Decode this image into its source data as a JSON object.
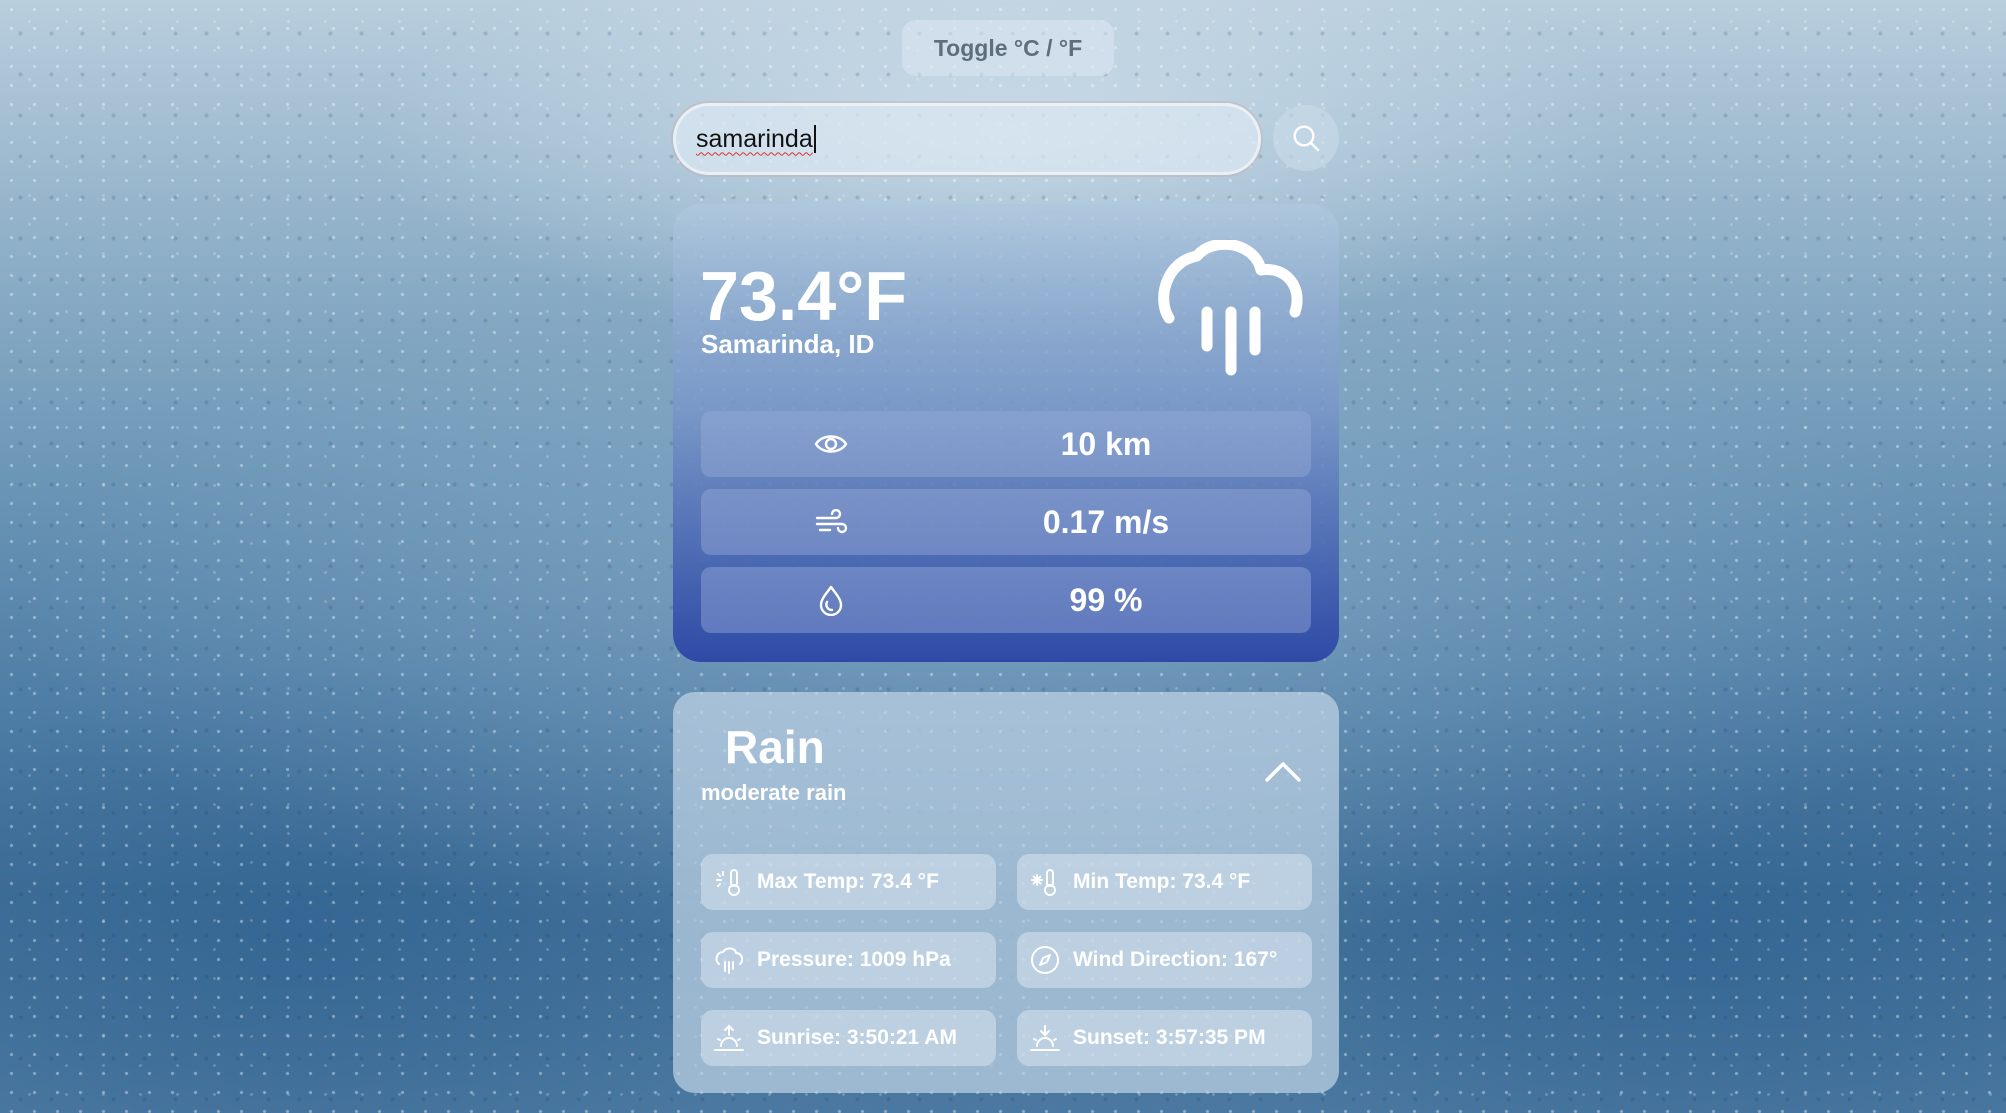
{
  "toggle": {
    "label": "Toggle °C / °F"
  },
  "search": {
    "value": "samarinda"
  },
  "current": {
    "temperature": "73.4°F",
    "location": "Samarinda, ID",
    "icon": "cloud-rain-icon",
    "stats": [
      {
        "icon": "eye-icon",
        "value": "10 km"
      },
      {
        "icon": "wind-icon",
        "value": "0.17 m/s"
      },
      {
        "icon": "humidity-icon",
        "value": "99 %"
      }
    ]
  },
  "details": {
    "condition": "Rain",
    "description": "moderate rain",
    "chips": [
      {
        "icon": "thermometer-sun-icon",
        "label": "Max Temp: 73.4 °F"
      },
      {
        "icon": "thermometer-snow-icon",
        "label": "Min Temp: 73.4 °F"
      },
      {
        "icon": "pressure-icon",
        "label": "Pressure: 1009 hPa"
      },
      {
        "icon": "compass-icon",
        "label": "Wind Direction: 167°"
      },
      {
        "icon": "sunrise-icon",
        "label": "Sunrise: 3:50:21 AM"
      },
      {
        "icon": "sunset-icon",
        "label": "Sunset: 3:57:35 PM"
      }
    ]
  }
}
